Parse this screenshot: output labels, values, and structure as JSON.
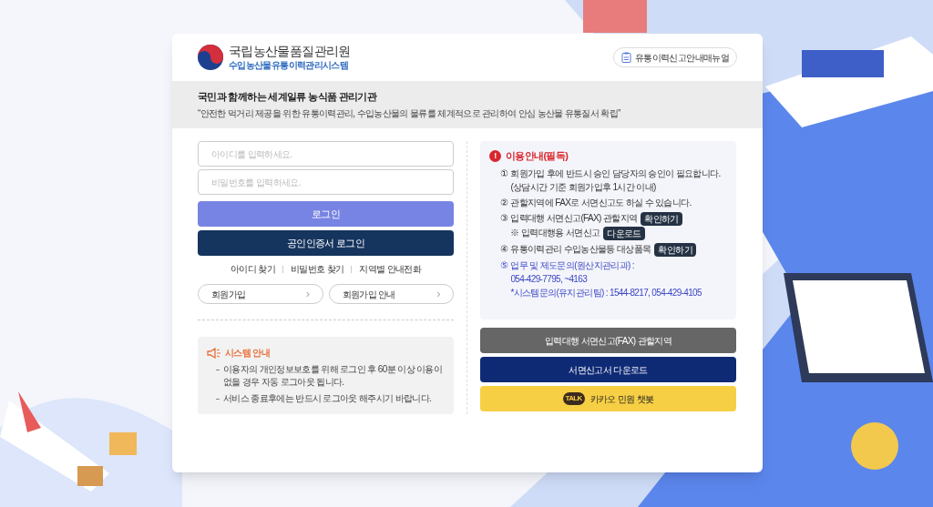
{
  "header": {
    "org_name": "국립농산물품질관리원",
    "system_name": "수입농산물유통이력관리시스템",
    "manual_button": "유통이력신고안내매뉴얼"
  },
  "banner": {
    "title": "국민과 함께하는 세계일류 농식품 관리기관",
    "quote": "“안전한 먹거리 제공을 위한 유통이력관리, 수입농산물의 물류를 체계적으로 관리하여 안심 농산물 유통질서 확립”"
  },
  "login": {
    "id_placeholder": "아이디를 입력하세요.",
    "pw_placeholder": "비밀번호를 입력하세요.",
    "login_button": "로그인",
    "cert_button": "공인인증서 로그인",
    "links": [
      "아이디 찾기",
      "비밀번호 찾기",
      "지역별 안내전화"
    ],
    "join_buttons": [
      {
        "label": "회원가입",
        "arrow": "›"
      },
      {
        "label": "회원가입 안내",
        "arrow": "›"
      }
    ]
  },
  "system_notice": {
    "title": "시스템 안내",
    "items": [
      "이용자의 개인정보보호를 위해 로그인 후 60분 이상 이용이 없을 경우 자동 로그아웃 됩니다.",
      "서비스 종료후에는 반드시 로그아웃 해주시기 바랍니다."
    ]
  },
  "usage_notice": {
    "icon": "!",
    "title": "이용안내(필독)",
    "items": [
      {
        "kind": "normal",
        "number": "①",
        "lines": [
          {
            "text": "회원가입 후에 반드시 승인 담당자의 승인이 필요합니다."
          },
          {
            "text": "(상담시간 기준 회원가입후 1시간 이내)"
          }
        ]
      },
      {
        "kind": "normal",
        "number": "②",
        "lines": [
          {
            "text": "관할지역에 FAX로 서면신고도 하실 수 있습니다."
          }
        ]
      },
      {
        "kind": "normal",
        "number": "③",
        "lines": [
          {
            "text": "입력대행 서면신고(FAX) 관할지역",
            "button": "확인하기"
          },
          {
            "text": "※ 입력대행용 서면신고",
            "button": "다운로드"
          }
        ]
      },
      {
        "kind": "normal",
        "number": "④",
        "lines": [
          {
            "text": "유통이력관리 수입농산물등 대상품목",
            "button": "확인하기"
          }
        ]
      },
      {
        "kind": "contact",
        "number": "⑤",
        "lines": [
          {
            "text": "업무 및 제도문의(원산지관리과) :"
          },
          {
            "text": "054-429-7795, ~4163"
          },
          {
            "text": "*시스템문의(유지관리팀) : 1544-8217, 054-429-4105"
          }
        ]
      }
    ]
  },
  "action_buttons": [
    {
      "kind": "gray",
      "label": "입력대행 서면신고(FAX) 관할지역"
    },
    {
      "kind": "navy",
      "label": "서면신고서 다운로드"
    },
    {
      "kind": "kakao",
      "label": "카카오 민원 챗봇",
      "icon_text": "TALK"
    }
  ]
}
